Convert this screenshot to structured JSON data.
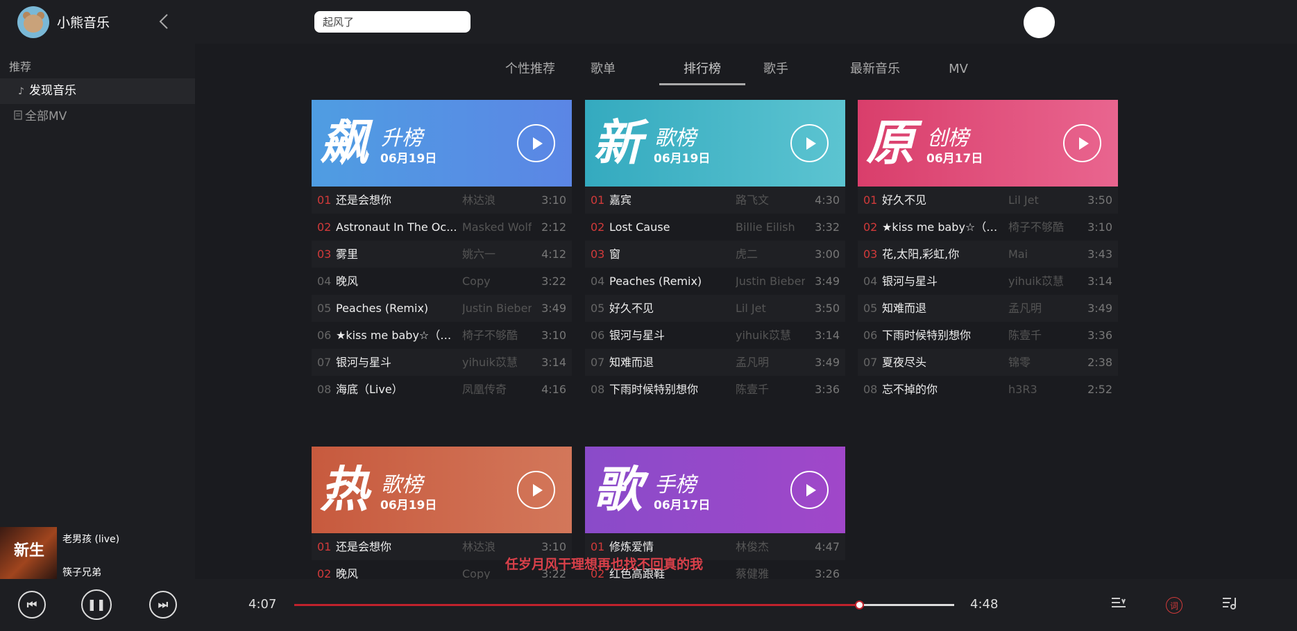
{
  "app": {
    "name": "小熊音乐"
  },
  "search": {
    "value": "起风了"
  },
  "sidebar": {
    "heading": "推荐",
    "items": [
      {
        "label": "发现音乐",
        "icon": "music-note-icon"
      },
      {
        "label": "全部MV",
        "icon": "document-icon"
      }
    ]
  },
  "tabs": [
    "个性推荐",
    "歌单",
    "排行榜",
    "歌手",
    "最新音乐",
    "MV"
  ],
  "charts": [
    {
      "big": "飙",
      "sub": "升榜",
      "date": "06月19日",
      "rows": [
        {
          "no": "01",
          "title": "还是会想你",
          "artist": "林达浪",
          "dur": "3:10"
        },
        {
          "no": "02",
          "title": "Astronaut In The Oc...",
          "artist": "Masked Wolf",
          "dur": "2:12"
        },
        {
          "no": "03",
          "title": "雾里",
          "artist": "姚六一",
          "dur": "4:12"
        },
        {
          "no": "04",
          "title": "晚风",
          "artist": "Copy",
          "dur": "3:22"
        },
        {
          "no": "05",
          "title": "Peaches (Remix)",
          "artist": "Justin Bieber",
          "dur": "3:49"
        },
        {
          "no": "06",
          "title": "★kiss me baby☆（吻...",
          "artist": "椅子不够酷",
          "dur": "3:10"
        },
        {
          "no": "07",
          "title": "银河与星斗",
          "artist": "yihuik苡慧",
          "dur": "3:14"
        },
        {
          "no": "08",
          "title": "海底（Live）",
          "artist": "凤凰传奇",
          "dur": "4:16"
        }
      ]
    },
    {
      "big": "新",
      "sub": "歌榜",
      "date": "06月19日",
      "rows": [
        {
          "no": "01",
          "title": "嘉宾",
          "artist": "路飞文",
          "dur": "4:30"
        },
        {
          "no": "02",
          "title": "Lost Cause",
          "artist": "Billie Eilish",
          "dur": "3:32"
        },
        {
          "no": "03",
          "title": "窗",
          "artist": "虎二",
          "dur": "3:00"
        },
        {
          "no": "04",
          "title": "Peaches (Remix)",
          "artist": "Justin Bieber",
          "dur": "3:49"
        },
        {
          "no": "05",
          "title": "好久不见",
          "artist": "Lil Jet",
          "dur": "3:50"
        },
        {
          "no": "06",
          "title": "银河与星斗",
          "artist": "yihuik苡慧",
          "dur": "3:14"
        },
        {
          "no": "07",
          "title": "知难而退",
          "artist": "孟凡明",
          "dur": "3:49"
        },
        {
          "no": "08",
          "title": "下雨时候特别想你",
          "artist": "陈壹千",
          "dur": "3:36"
        }
      ]
    },
    {
      "big": "原",
      "sub": "创榜",
      "date": "06月17日",
      "rows": [
        {
          "no": "01",
          "title": "好久不见",
          "artist": "Lil Jet",
          "dur": "3:50"
        },
        {
          "no": "02",
          "title": "★kiss me baby☆（吻...",
          "artist": "椅子不够酷",
          "dur": "3:10"
        },
        {
          "no": "03",
          "title": "花,太阳,彩虹,你",
          "artist": "Mai",
          "dur": "3:43"
        },
        {
          "no": "04",
          "title": "银河与星斗",
          "artist": "yihuik苡慧",
          "dur": "3:14"
        },
        {
          "no": "05",
          "title": "知难而退",
          "artist": "孟凡明",
          "dur": "3:49"
        },
        {
          "no": "06",
          "title": "下雨时候特别想你",
          "artist": "陈壹千",
          "dur": "3:36"
        },
        {
          "no": "07",
          "title": "夏夜尽头",
          "artist": "锦零",
          "dur": "2:38"
        },
        {
          "no": "08",
          "title": "忘不掉的你",
          "artist": "h3R3",
          "dur": "2:52"
        }
      ]
    },
    {
      "big": "热",
      "sub": "歌榜",
      "date": "06月19日",
      "rows": [
        {
          "no": "01",
          "title": "还是会想你",
          "artist": "林达浪",
          "dur": "3:10"
        },
        {
          "no": "02",
          "title": "晚风",
          "artist": "Copy",
          "dur": "3:22"
        }
      ]
    },
    {
      "big": "歌",
      "sub": "手榜",
      "date": "06月17日",
      "rows": [
        {
          "no": "01",
          "title": "修炼爱情",
          "artist": "林俊杰",
          "dur": "4:47"
        },
        {
          "no": "02",
          "title": "红色高跟鞋",
          "artist": "蔡健雅",
          "dur": "3:26"
        }
      ]
    }
  ],
  "colors": {
    "gradients": [
      [
        "#4f9de2",
        "#5b86e5"
      ],
      [
        "#34aabf",
        "#5cc4d1"
      ],
      [
        "#d93e6b",
        "#e9658f"
      ],
      [
        "#c75a3e",
        "#d3775a"
      ],
      [
        "#8a4bc9",
        "#a047c9"
      ]
    ],
    "accent": "#c0222c"
  },
  "now_playing": {
    "title": "老男孩 (live)",
    "artist": "筷子兄弟",
    "cover_text": "新生"
  },
  "lyric": "任岁月风干理想再也找不回真的我",
  "player": {
    "elapsed": "4:07",
    "total": "4:48",
    "progress": 0.857,
    "lyric_toggle_label": "词"
  }
}
